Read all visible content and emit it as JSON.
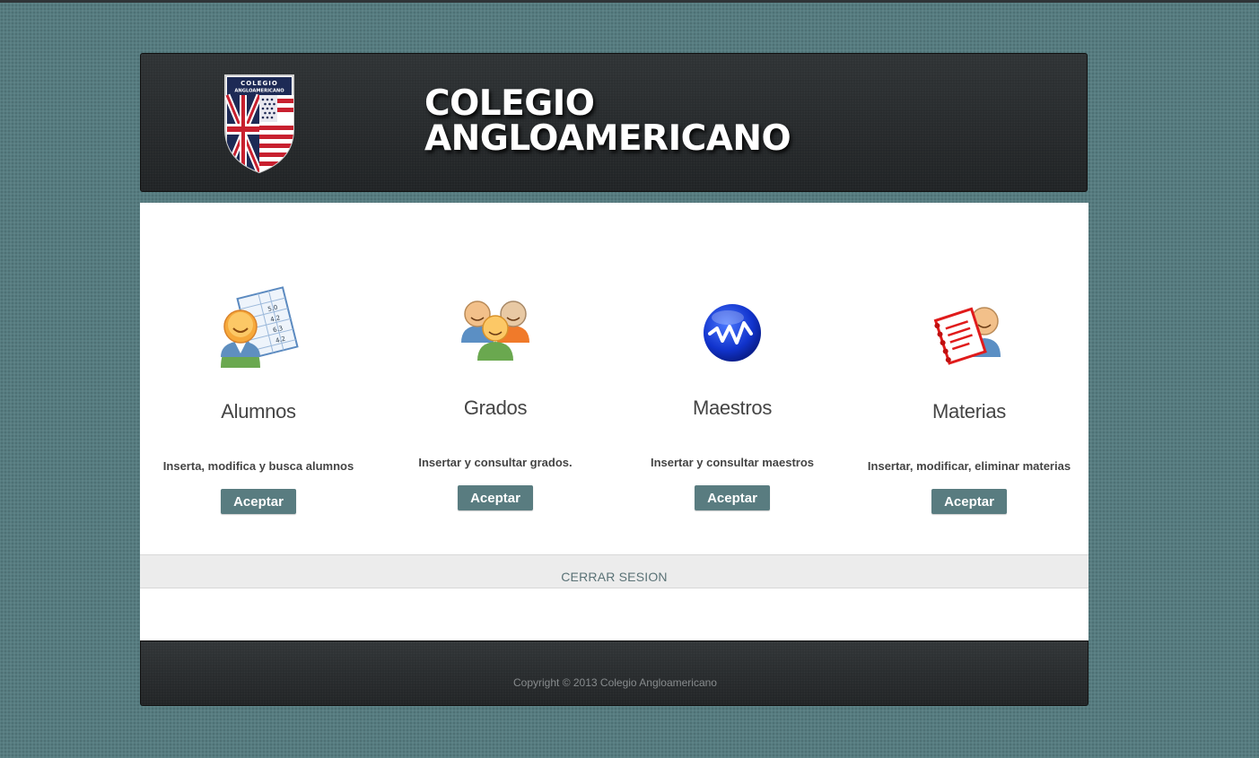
{
  "header": {
    "logo_label": "COLEGIO ANGLOAMERICANO",
    "title_line1": "COLEGIO",
    "title_line2": "ANGLOAMERICANO"
  },
  "cards": [
    {
      "title": "Alumnos",
      "description": "Inserta, modifica y busca alumnos",
      "button": "Aceptar",
      "icon": "student-grades-icon"
    },
    {
      "title": "Grados",
      "description": "Insertar y consultar grados.",
      "button": "Aceptar",
      "icon": "group-users-icon"
    },
    {
      "title": "Maestros",
      "description": "Insertar y consultar maestros",
      "button": "Aceptar",
      "icon": "activity-wave-icon"
    },
    {
      "title": "Materias",
      "description": "Insertar, modificar, eliminar materias",
      "button": "Aceptar",
      "icon": "notebook-user-icon"
    }
  ],
  "logout": {
    "label": "CERRAR SESION"
  },
  "footer": {
    "copyright": "Copyright © 2013 Colegio Angloamericano"
  },
  "colors": {
    "background": "#567c80",
    "header": "#26292b",
    "button": "#597c80",
    "logout_bar": "#ececec"
  }
}
